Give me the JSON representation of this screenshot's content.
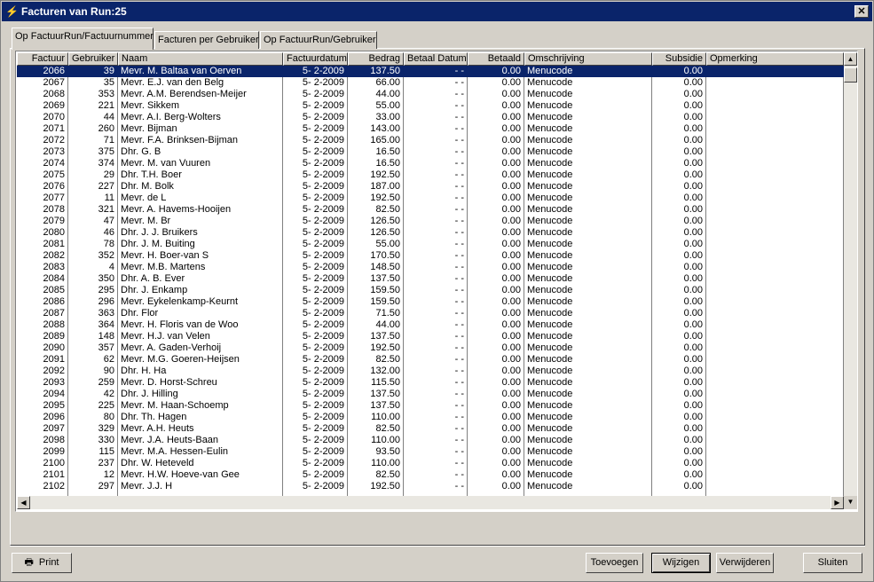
{
  "window": {
    "title": "Facturen van Run:25",
    "close_label": "✕"
  },
  "tabs": [
    {
      "label": "Op FactuurRun/Factuurnummer",
      "active": true
    },
    {
      "label": "Facturen per Gebruiker",
      "active": false
    },
    {
      "label": "Op FactuurRun/Gebruiker",
      "active": false
    }
  ],
  "columns": [
    "Factuur",
    "Gebruiker",
    "Naam",
    "Factuurdatum",
    "Bedrag",
    "Betaal Datum",
    "Betaald",
    "Omschrijving",
    "Subsidie",
    "Opmerking"
  ],
  "rows": [
    [
      "2066",
      "39",
      "Mevr. M. Baltaa van Oerven",
      "5- 2-2009",
      "137.50",
      "- -",
      "0.00",
      "Menucode",
      "0.00",
      ""
    ],
    [
      "2067",
      "35",
      "Mevr. E.J. van den Belg",
      "5- 2-2009",
      "66.00",
      "- -",
      "0.00",
      "Menucode",
      "0.00",
      ""
    ],
    [
      "2068",
      "353",
      "Mevr. A.M. Berendsen-Meijer",
      "5- 2-2009",
      "44.00",
      "- -",
      "0.00",
      "Menucode",
      "0.00",
      ""
    ],
    [
      "2069",
      "221",
      "Mevr. Sikkem",
      "5- 2-2009",
      "55.00",
      "- -",
      "0.00",
      "Menucode",
      "0.00",
      ""
    ],
    [
      "2070",
      "44",
      "Mevr. A.I. Berg-Wolters",
      "5- 2-2009",
      "33.00",
      "- -",
      "0.00",
      "Menucode",
      "0.00",
      ""
    ],
    [
      "2071",
      "260",
      "Mevr. Bijman",
      "5- 2-2009",
      "143.00",
      "- -",
      "0.00",
      "Menucode",
      "0.00",
      ""
    ],
    [
      "2072",
      "71",
      "Mevr. F.A. Brinksen-Bijman",
      "5- 2-2009",
      "165.00",
      "- -",
      "0.00",
      "Menucode",
      "0.00",
      ""
    ],
    [
      "2073",
      "375",
      "Dhr. G. B",
      "5- 2-2009",
      "16.50",
      "- -",
      "0.00",
      "Menucode",
      "0.00",
      ""
    ],
    [
      "2074",
      "374",
      "Mevr. M. van Vuuren",
      "5- 2-2009",
      "16.50",
      "- -",
      "0.00",
      "Menucode",
      "0.00",
      ""
    ],
    [
      "2075",
      "29",
      "Dhr. T.H. Boer",
      "5- 2-2009",
      "192.50",
      "- -",
      "0.00",
      "Menucode",
      "0.00",
      ""
    ],
    [
      "2076",
      "227",
      "Dhr. M. Bolk",
      "5- 2-2009",
      "187.00",
      "- -",
      "0.00",
      "Menucode",
      "0.00",
      ""
    ],
    [
      "2077",
      "11",
      "Mevr. de L",
      "5- 2-2009",
      "192.50",
      "- -",
      "0.00",
      "Menucode",
      "0.00",
      ""
    ],
    [
      "2078",
      "321",
      "Mevr. A. Havems-Hooijen",
      "5- 2-2009",
      "82.50",
      "- -",
      "0.00",
      "Menucode",
      "0.00",
      ""
    ],
    [
      "2079",
      "47",
      "Mevr. M. Br",
      "5- 2-2009",
      "126.50",
      "- -",
      "0.00",
      "Menucode",
      "0.00",
      ""
    ],
    [
      "2080",
      "46",
      "Dhr. J. J. Bruikers",
      "5- 2-2009",
      "126.50",
      "- -",
      "0.00",
      "Menucode",
      "0.00",
      ""
    ],
    [
      "2081",
      "78",
      "Dhr. J. M. Buiting",
      "5- 2-2009",
      "55.00",
      "- -",
      "0.00",
      "Menucode",
      "0.00",
      ""
    ],
    [
      "2082",
      "352",
      "Mevr. H. Boer-van S",
      "5- 2-2009",
      "170.50",
      "- -",
      "0.00",
      "Menucode",
      "0.00",
      ""
    ],
    [
      "2083",
      "4",
      "Mevr. M.B. Martens",
      "5- 2-2009",
      "148.50",
      "- -",
      "0.00",
      "Menucode",
      "0.00",
      ""
    ],
    [
      "2084",
      "350",
      "Dhr. A. B. Ever",
      "5- 2-2009",
      "137.50",
      "- -",
      "0.00",
      "Menucode",
      "0.00",
      ""
    ],
    [
      "2085",
      "295",
      "Dhr. J. Enkamp",
      "5- 2-2009",
      "159.50",
      "- -",
      "0.00",
      "Menucode",
      "0.00",
      ""
    ],
    [
      "2086",
      "296",
      "Mevr. Eykelenkamp-Keurnt",
      "5- 2-2009",
      "159.50",
      "- -",
      "0.00",
      "Menucode",
      "0.00",
      ""
    ],
    [
      "2087",
      "363",
      "Dhr. Flor",
      "5- 2-2009",
      "71.50",
      "- -",
      "0.00",
      "Menucode",
      "0.00",
      ""
    ],
    [
      "2088",
      "364",
      "Mevr. H. Floris van de Woo",
      "5- 2-2009",
      "44.00",
      "- -",
      "0.00",
      "Menucode",
      "0.00",
      ""
    ],
    [
      "2089",
      "148",
      "Mevr. H.J. van Velen",
      "5- 2-2009",
      "137.50",
      "- -",
      "0.00",
      "Menucode",
      "0.00",
      ""
    ],
    [
      "2090",
      "357",
      "Mevr. A. Gaden-Verhoij",
      "5- 2-2009",
      "192.50",
      "- -",
      "0.00",
      "Menucode",
      "0.00",
      ""
    ],
    [
      "2091",
      "62",
      "Mevr. M.G. Goeren-Heijsen",
      "5- 2-2009",
      "82.50",
      "- -",
      "0.00",
      "Menucode",
      "0.00",
      ""
    ],
    [
      "2092",
      "90",
      "Dhr. H. Ha",
      "5- 2-2009",
      "132.00",
      "- -",
      "0.00",
      "Menucode",
      "0.00",
      ""
    ],
    [
      "2093",
      "259",
      "Mevr. D. Horst-Schreu",
      "5- 2-2009",
      "115.50",
      "- -",
      "0.00",
      "Menucode",
      "0.00",
      ""
    ],
    [
      "2094",
      "42",
      "Dhr. J. Hilling",
      "5- 2-2009",
      "137.50",
      "- -",
      "0.00",
      "Menucode",
      "0.00",
      ""
    ],
    [
      "2095",
      "225",
      "Mevr. M. Haan-Schoemp",
      "5- 2-2009",
      "137.50",
      "- -",
      "0.00",
      "Menucode",
      "0.00",
      ""
    ],
    [
      "2096",
      "80",
      "Dhr. Th. Hagen",
      "5- 2-2009",
      "110.00",
      "- -",
      "0.00",
      "Menucode",
      "0.00",
      ""
    ],
    [
      "2097",
      "329",
      "Mevr. A.H. Heuts",
      "5- 2-2009",
      "82.50",
      "- -",
      "0.00",
      "Menucode",
      "0.00",
      ""
    ],
    [
      "2098",
      "330",
      "Mevr. J.A. Heuts-Baan",
      "5- 2-2009",
      "110.00",
      "- -",
      "0.00",
      "Menucode",
      "0.00",
      ""
    ],
    [
      "2099",
      "115",
      "Mevr. M.A. Hessen-Eulin",
      "5- 2-2009",
      "93.50",
      "- -",
      "0.00",
      "Menucode",
      "0.00",
      ""
    ],
    [
      "2100",
      "237",
      "Dhr. W. Heteveld",
      "5- 2-2009",
      "110.00",
      "- -",
      "0.00",
      "Menucode",
      "0.00",
      ""
    ],
    [
      "2101",
      "12",
      "Mevr. H.W. Hoeve-van Gee",
      "5- 2-2009",
      "82.50",
      "- -",
      "0.00",
      "Menucode",
      "0.00",
      ""
    ],
    [
      "2102",
      "297",
      "Mevr. J.J. H",
      "5- 2-2009",
      "192.50",
      "- -",
      "0.00",
      "Menucode",
      "0.00",
      ""
    ]
  ],
  "selected_row": 0,
  "buttons": {
    "print": "Print",
    "toevoegen": "Toevoegen",
    "wijzigen": "Wijzigen",
    "verwijderen": "Verwijderen",
    "sluiten": "Sluiten"
  },
  "icons": {
    "app": "app-icon",
    "print": "printer-icon"
  },
  "colors": {
    "titlebar": "#0a246a",
    "selection": "#0a246a",
    "face": "#d4d0c8"
  }
}
